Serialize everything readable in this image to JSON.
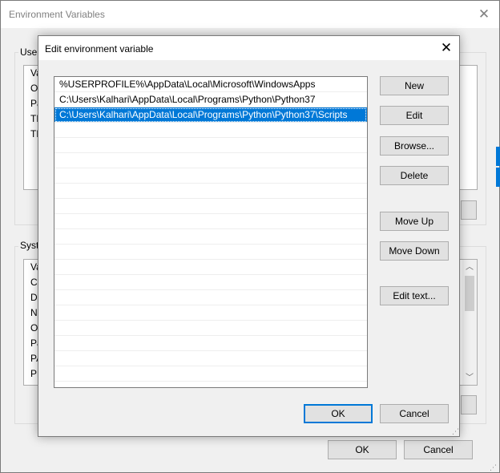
{
  "background_window": {
    "title": "Environment Variables",
    "user_group_label": "User",
    "user_list_rows": [
      "Va",
      "On",
      "Pa",
      "TE",
      "TM"
    ],
    "system_group_label": "Syste",
    "system_list_rows": [
      "Va",
      "Co",
      "Dr",
      "NU",
      "OS",
      "Pa",
      "PA",
      "PR"
    ],
    "ok_label": "OK",
    "cancel_label": "Cancel"
  },
  "dialog": {
    "title": "Edit environment variable",
    "paths": [
      "%USERPROFILE%\\AppData\\Local\\Microsoft\\WindowsApps",
      "C:\\Users\\Kalhari\\AppData\\Local\\Programs\\Python\\Python37",
      "C:\\Users\\Kalhari\\AppData\\Local\\Programs\\Python\\Python37\\Scripts"
    ],
    "selected_index": 2,
    "buttons": {
      "new": "New",
      "edit": "Edit",
      "browse": "Browse...",
      "delete": "Delete",
      "move_up": "Move Up",
      "move_down": "Move Down",
      "edit_text": "Edit text..."
    },
    "ok_label": "OK",
    "cancel_label": "Cancel"
  },
  "icons": {
    "close": "close-icon",
    "resize_grip": "resize-grip-icon",
    "scroll_up": "chevron-up-icon",
    "scroll_down": "chevron-down-icon"
  },
  "colors": {
    "accent": "#0078d7",
    "dialog_bg": "#f0f0f0",
    "button_bg": "#e1e1e1"
  }
}
